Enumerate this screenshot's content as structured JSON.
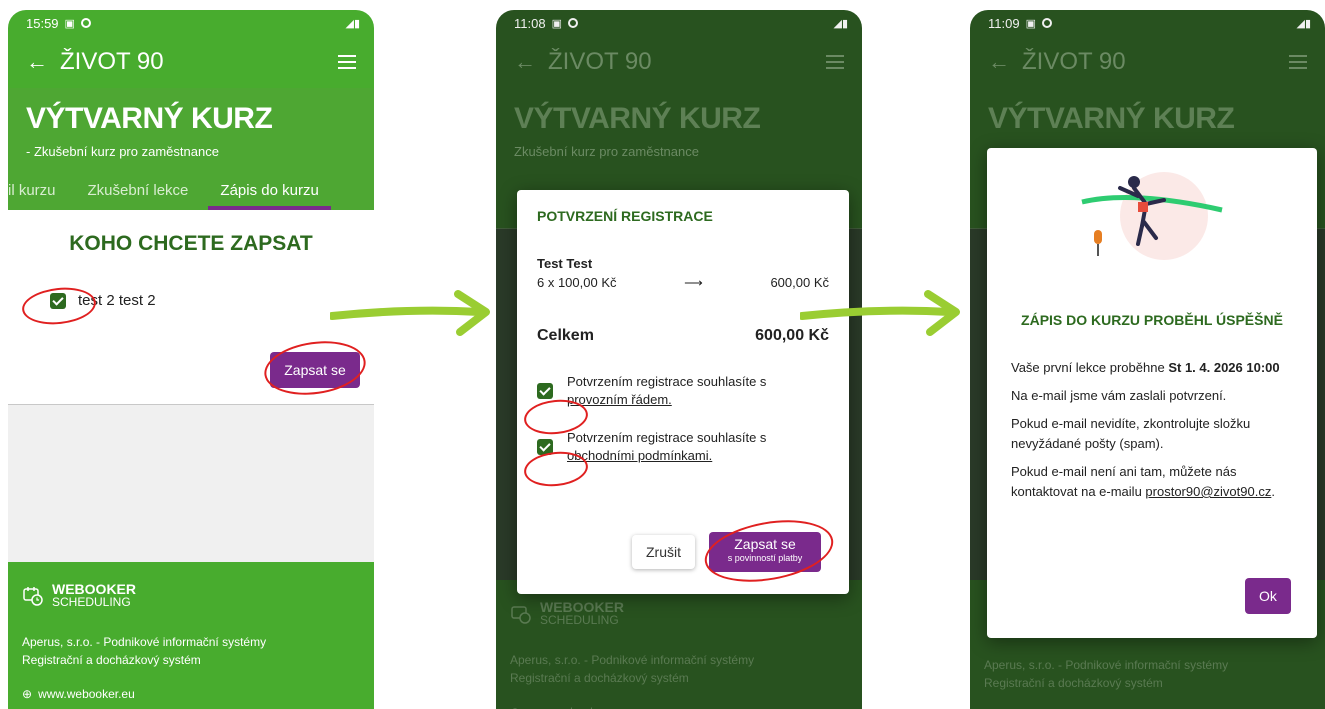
{
  "colors": {
    "brand_green": "#48ac2e",
    "dark_green": "#2d6a1f",
    "accent_purple": "#7a2a8c",
    "annotation_red": "#e02020",
    "arrow_green": "#9acd32"
  },
  "common": {
    "app_title": "ŽIVOT 90",
    "course_title": "VÝTVARNÝ KURZ",
    "course_sub": "- Zkušební kurz pro zaměstnance",
    "course_sub_dim": "Zkušební kurz pro zaměstnance",
    "footer_brand": "WEBOOKER",
    "footer_brand_sub": "SCHEDULING",
    "footer_company": "Aperus, s.r.o. - Podnikové informační systémy",
    "footer_system": "Registrační a docházkový systém",
    "footer_site": "www.webooker.eu"
  },
  "screen1": {
    "time": "15:59",
    "tabs": [
      "il kurzu",
      "Zkušební lekce",
      "Zápis do kurzu"
    ],
    "heading": "KOHO CHCETE ZAPSAT",
    "person_label": "test 2 test 2",
    "enroll_button": "Zapsat se"
  },
  "screen2": {
    "time": "11:08",
    "dialog_title": "POTVRZENÍ REGISTRACE",
    "person": "Test Test",
    "price_qty": "6 x 100,00 Kč",
    "arrow": "⟶",
    "price_sum": "600,00 Kč",
    "total_label": "Celkem",
    "total_value": "600,00 Kč",
    "consent1_text": "Potvrzením registrace souhlasíte s",
    "consent1_link": "provozním řádem.",
    "consent2_text": "Potvrzením registrace souhlasíte s",
    "consent2_link": "obchodními podmínkami.",
    "cancel_button": "Zrušit",
    "confirm_button": "Zapsat se",
    "confirm_button_sub": "s povinností platby"
  },
  "screen3": {
    "time": "11:09",
    "success_title": "ZÁPIS DO KURZU PROBĚHL ÚSPĚŠNĚ",
    "lesson_text": "Vaše první lekce proběhne",
    "lesson_date": "St 1. 4. 2026 10:00",
    "email_sent": "Na e-mail jsme vám zaslali potvrzení.",
    "spam_note": "Pokud e-mail nevidíte, zkontrolujte složku nevyžádané pošty (spam).",
    "contact_note": "Pokud e-mail není ani tam, můžete nás kontaktovat na e-mailu",
    "contact_email": "prostor90@zivot90.cz",
    "contact_end": ".",
    "ok_button": "Ok"
  }
}
